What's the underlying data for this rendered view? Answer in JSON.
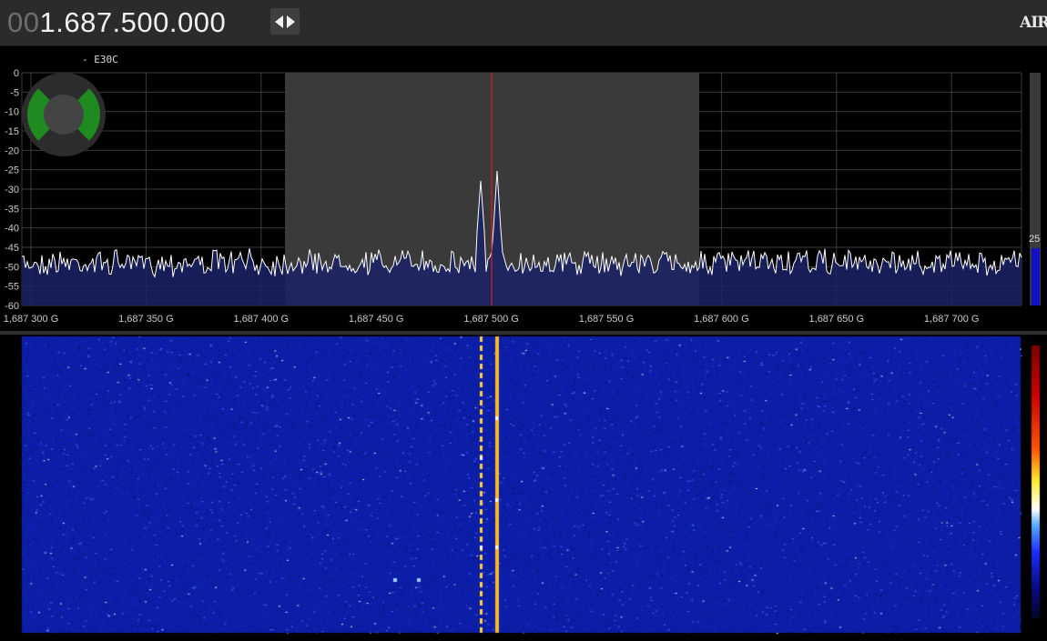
{
  "header": {
    "freq_lead": "00",
    "freq_main": "1.687.500.000",
    "logo": "AIR"
  },
  "spectrum": {
    "station_label": "- E30C",
    "db_ticks": [
      "0",
      "-5",
      "-10",
      "-15",
      "-20",
      "-25",
      "-30",
      "-35",
      "-40",
      "-45",
      "-50",
      "-55",
      "-60"
    ],
    "freq_ticks": [
      "1,687 300 G",
      "1,687 350 G",
      "1,687 400 G",
      "1,687 450 G",
      "1,687 500 G",
      "1,687 550 G",
      "1,687 600 G",
      "1,687 650 G",
      "1,687 700 G"
    ],
    "side_value": "25",
    "colors": {
      "grid": "#3c3c3c",
      "passband": "#3a3a3a",
      "trace": "#ffffff",
      "tuning_line": "#cc2222",
      "fill": "#1a2266",
      "knob_green": "#1f8a1f"
    }
  },
  "waterfall": {
    "colors": {
      "background": "#0c1ea8",
      "signal": "#ffd33a"
    }
  }
}
